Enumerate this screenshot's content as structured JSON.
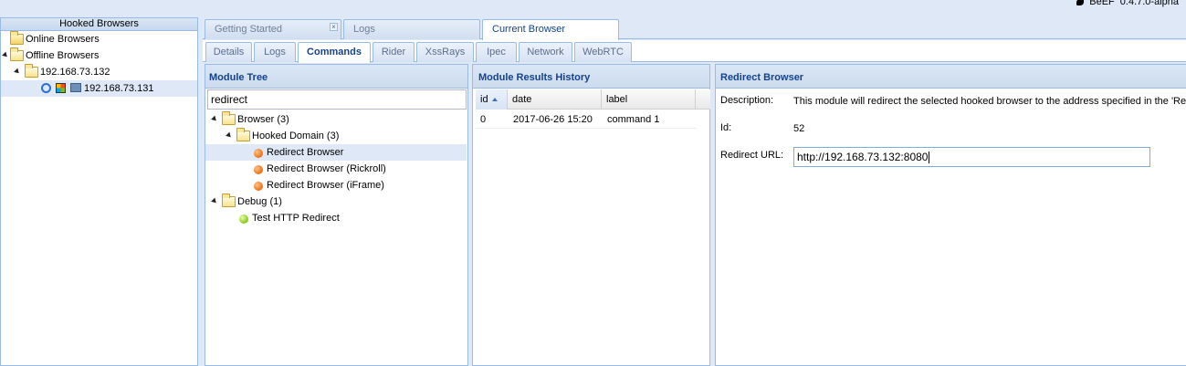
{
  "brand": {
    "name": "BeEF",
    "version": "0.4.7.0-alpha"
  },
  "left_panel": {
    "title": "Hooked Browsers",
    "online": "Online Browsers",
    "offline": "Offline Browsers",
    "host": "192.168.73.132",
    "browser": "192.168.73.131"
  },
  "main_tabs": [
    "Getting Started",
    "Logs",
    "Current Browser"
  ],
  "sub_tabs": [
    "Details",
    "Logs",
    "Commands",
    "Rider",
    "XssRays",
    "Ipec",
    "Network",
    "WebRTC"
  ],
  "module_tree": {
    "title": "Module Tree",
    "filter_value": "redirect",
    "items": [
      {
        "label": "Browser (3)",
        "kind": "folder"
      },
      {
        "label": "Hooked Domain (3)",
        "kind": "folder"
      },
      {
        "label": "Redirect Browser",
        "kind": "module",
        "status": "orange"
      },
      {
        "label": "Redirect Browser (Rickroll)",
        "kind": "module",
        "status": "orange"
      },
      {
        "label": "Redirect Browser (iFrame)",
        "kind": "module",
        "status": "orange"
      },
      {
        "label": "Debug (1)",
        "kind": "folder"
      },
      {
        "label": "Test HTTP Redirect",
        "kind": "module",
        "status": "green"
      }
    ]
  },
  "results": {
    "title": "Module Results History",
    "columns": [
      "id",
      "date",
      "label"
    ],
    "rows": [
      {
        "id": "0",
        "date": "2017-06-26 15:20",
        "label": "command 1"
      }
    ]
  },
  "detail": {
    "title": "Redirect Browser",
    "description_label": "Description:",
    "description": "This module will redirect the selected hooked browser to the address specified in the 'Re",
    "id_label": "Id:",
    "id": "52",
    "url_label": "Redirect URL:",
    "url_value": "http://192.168.73.132:8080"
  },
  "colors": {
    "header_text": "#15428b",
    "border": "#99bbe8",
    "selection": "#dfe8f6"
  }
}
